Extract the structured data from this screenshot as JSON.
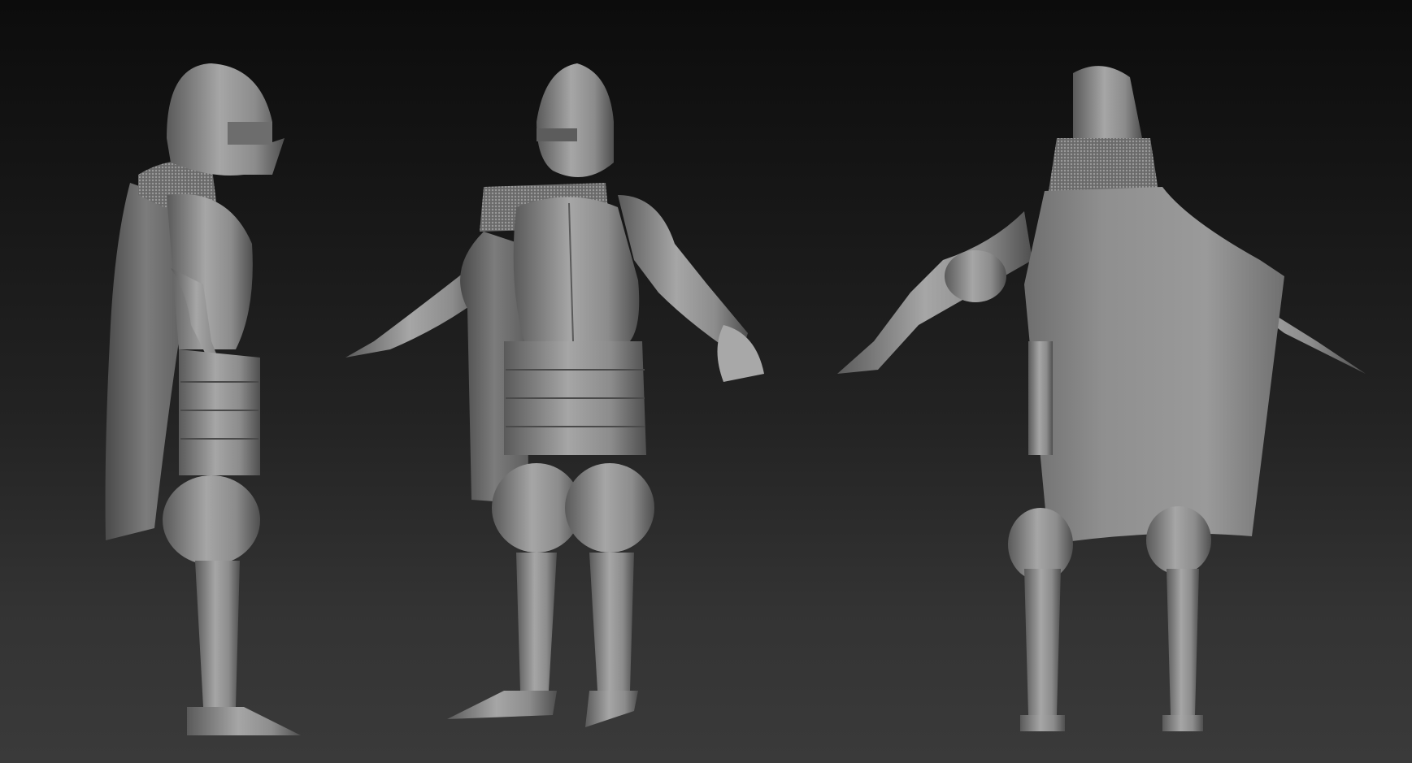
{
  "scene": {
    "background_top": "#0c0c0c",
    "background_bottom": "#3a3a3a",
    "material_color": "#8a8a8a",
    "views": [
      {
        "id": "side",
        "icon": "knight-side-view"
      },
      {
        "id": "front",
        "icon": "knight-front-view"
      },
      {
        "id": "back",
        "icon": "knight-back-view"
      }
    ]
  }
}
